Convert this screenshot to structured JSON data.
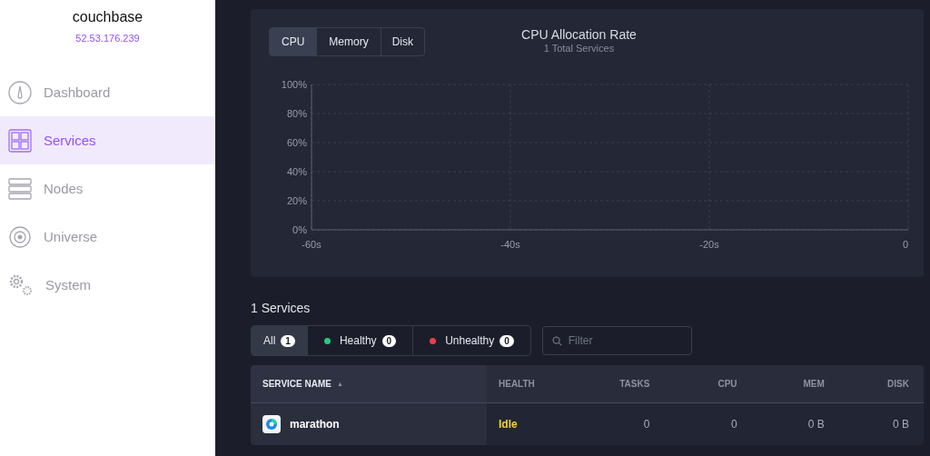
{
  "cluster": {
    "name": "couchbase",
    "address": "52.53.176.239"
  },
  "sidebar": {
    "items": [
      {
        "kind": "dashboard",
        "label": "Dashboard",
        "selected": false
      },
      {
        "kind": "services",
        "label": "Services",
        "selected": true
      },
      {
        "kind": "nodes",
        "label": "Nodes",
        "selected": false
      },
      {
        "kind": "universe",
        "label": "Universe",
        "selected": false
      },
      {
        "kind": "system",
        "label": "System",
        "selected": false
      }
    ]
  },
  "chart_panel": {
    "tabs": [
      {
        "label": "CPU",
        "selected": true
      },
      {
        "label": "Memory",
        "selected": false
      },
      {
        "label": "Disk",
        "selected": false
      }
    ],
    "title": "CPU Allocation Rate",
    "subtitle": "1 Total Services",
    "chart_data": {
      "type": "line",
      "grid": true,
      "xlim": [
        -60,
        0
      ],
      "ylim": [
        0,
        100
      ],
      "xticks": [
        {
          "value": -60,
          "label": "-60s"
        },
        {
          "value": -40,
          "label": "-40s"
        },
        {
          "value": -20,
          "label": "-20s"
        },
        {
          "value": 0,
          "label": "0"
        }
      ],
      "yticks": [
        {
          "value": 0,
          "label": "0%"
        },
        {
          "value": 20,
          "label": "20%"
        },
        {
          "value": 40,
          "label": "40%"
        },
        {
          "value": 60,
          "label": "60%"
        },
        {
          "value": 80,
          "label": "80%"
        },
        {
          "value": 100,
          "label": "100%"
        }
      ]
    }
  },
  "services": {
    "heading": "1 Services",
    "filters": [
      {
        "label": "All",
        "count": "1",
        "selected": true
      },
      {
        "label": "Healthy",
        "count": "0",
        "color": "#27c97f",
        "selected": false
      },
      {
        "label": "Unhealthy",
        "count": "0",
        "color": "#ef3a4c",
        "selected": false
      }
    ],
    "filter_field": {
      "placeholder": "Filter"
    },
    "table": {
      "columns": [
        {
          "label": "SERVICE NAME",
          "sorted": true
        },
        {
          "label": "HEALTH",
          "sorted": false
        },
        {
          "label": "TASKS",
          "sorted": false
        },
        {
          "label": "CPU",
          "sorted": false
        },
        {
          "label": "MEM",
          "sorted": false
        },
        {
          "label": "DISK",
          "sorted": false
        }
      ],
      "sort_mark": "▲",
      "rows": [
        {
          "name": "marathon",
          "health": "Idle",
          "tasks": "0",
          "cpu": "0",
          "mem": "0 B",
          "disk": "0 B"
        }
      ]
    }
  }
}
